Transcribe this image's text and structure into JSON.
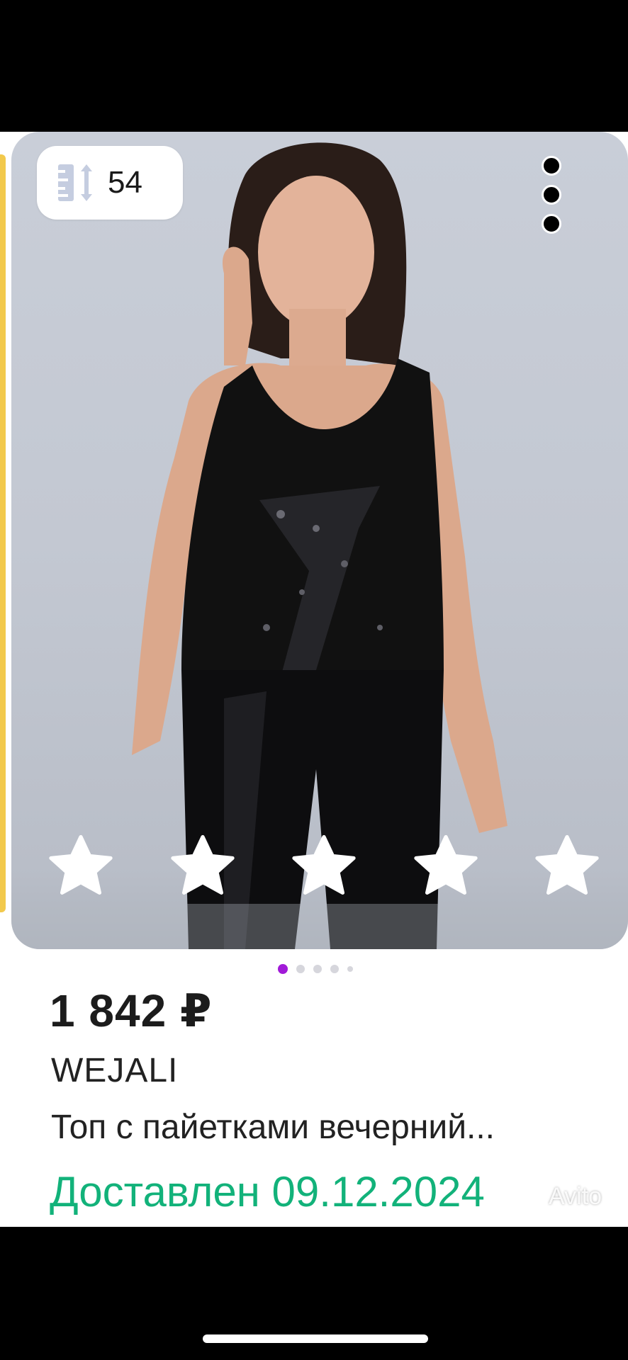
{
  "product_card": {
    "size_badge": {
      "icon": "size-arrows-icon",
      "value": "54"
    },
    "more_menu_icon": "more-vertical-icon",
    "rating": {
      "stars_total": 5,
      "stars_filled": 5,
      "star_color": "#ffffff"
    },
    "gallery": {
      "images_total": 5,
      "active_index": 0,
      "active_color": "#a11ad8"
    },
    "price": "1 842 ₽",
    "brand": "WEJALI",
    "title": "Топ с пайетками вечерний...",
    "delivery_status": "Доставлен 09.12.2024",
    "delivery_color": "#12b27a"
  },
  "watermark": {
    "text": "Avito"
  }
}
